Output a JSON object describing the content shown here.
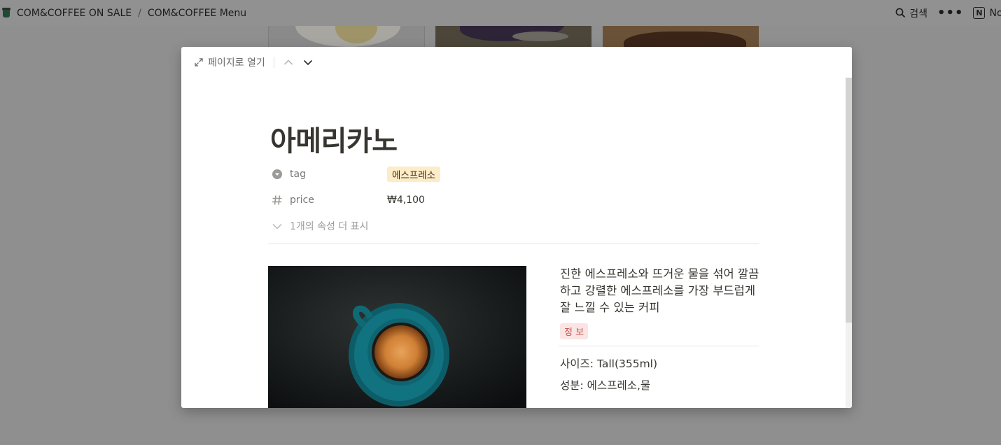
{
  "topbar": {
    "breadcrumb": [
      "COM&COFFEE ON SALE",
      "COM&COFFEE Menu"
    ],
    "separator": "/",
    "search_label": "검색",
    "more_label": "•••",
    "notion_label": "Not"
  },
  "modal": {
    "open_page_label": "페이지로 열기",
    "title": "아메리카노",
    "properties": [
      {
        "name": "tag",
        "value": "에스프레소",
        "icon": "dropdown-circle-icon",
        "chip_color": "#fdecc8"
      },
      {
        "name": "price",
        "value": "₩4,100",
        "icon": "hash-icon"
      }
    ],
    "more_properties_label": "1개의 속성 더 표시",
    "description": "진한 에스프레소와 뜨거운 물을 섞어  깔끔하고 강렬한 에스프레소를 가장 부드럽게 잘 느낄 수 있는 커피",
    "info_chip": "정 보",
    "size_spec": "사이즈:  Tall(355ml)",
    "ingredients_spec": "성분: 에스프레소,물"
  },
  "colors": {
    "overlay": "#8f8f8f",
    "tag_chip": "#fdecc8",
    "info_chip_bg": "#fbe4e4",
    "info_chip_text": "#c4554d",
    "cup": "#0f6470"
  }
}
